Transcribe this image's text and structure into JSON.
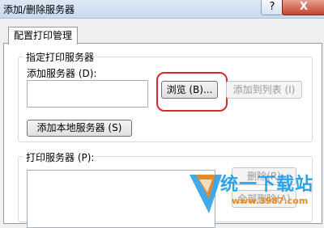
{
  "window": {
    "title": "添加/删除服务器",
    "help_label": "?",
    "close_label": "X"
  },
  "tabs": [
    {
      "label": "配置打印管理",
      "active": true
    }
  ],
  "specify_group": {
    "legend": "指定打印服务器",
    "add_server_label": "添加服务器 (D):",
    "add_server_value": "",
    "browse_button": "浏览 (B)...",
    "add_to_list_button": "添加到列表 (I)",
    "add_local_button": "添加本地服务器 (S)"
  },
  "print_servers_group": {
    "legend": "打印服务器 (P):",
    "items": [],
    "remove_button": "删除(R)",
    "remove_all_button": "全部删除(A)"
  },
  "watermark": {
    "text": "统一下载站",
    "url": "www.3987.com"
  },
  "colors": {
    "highlight": "#d42a2a",
    "watermark_blue": "#2fa1e4",
    "watermark_orange": "#e78b24"
  }
}
